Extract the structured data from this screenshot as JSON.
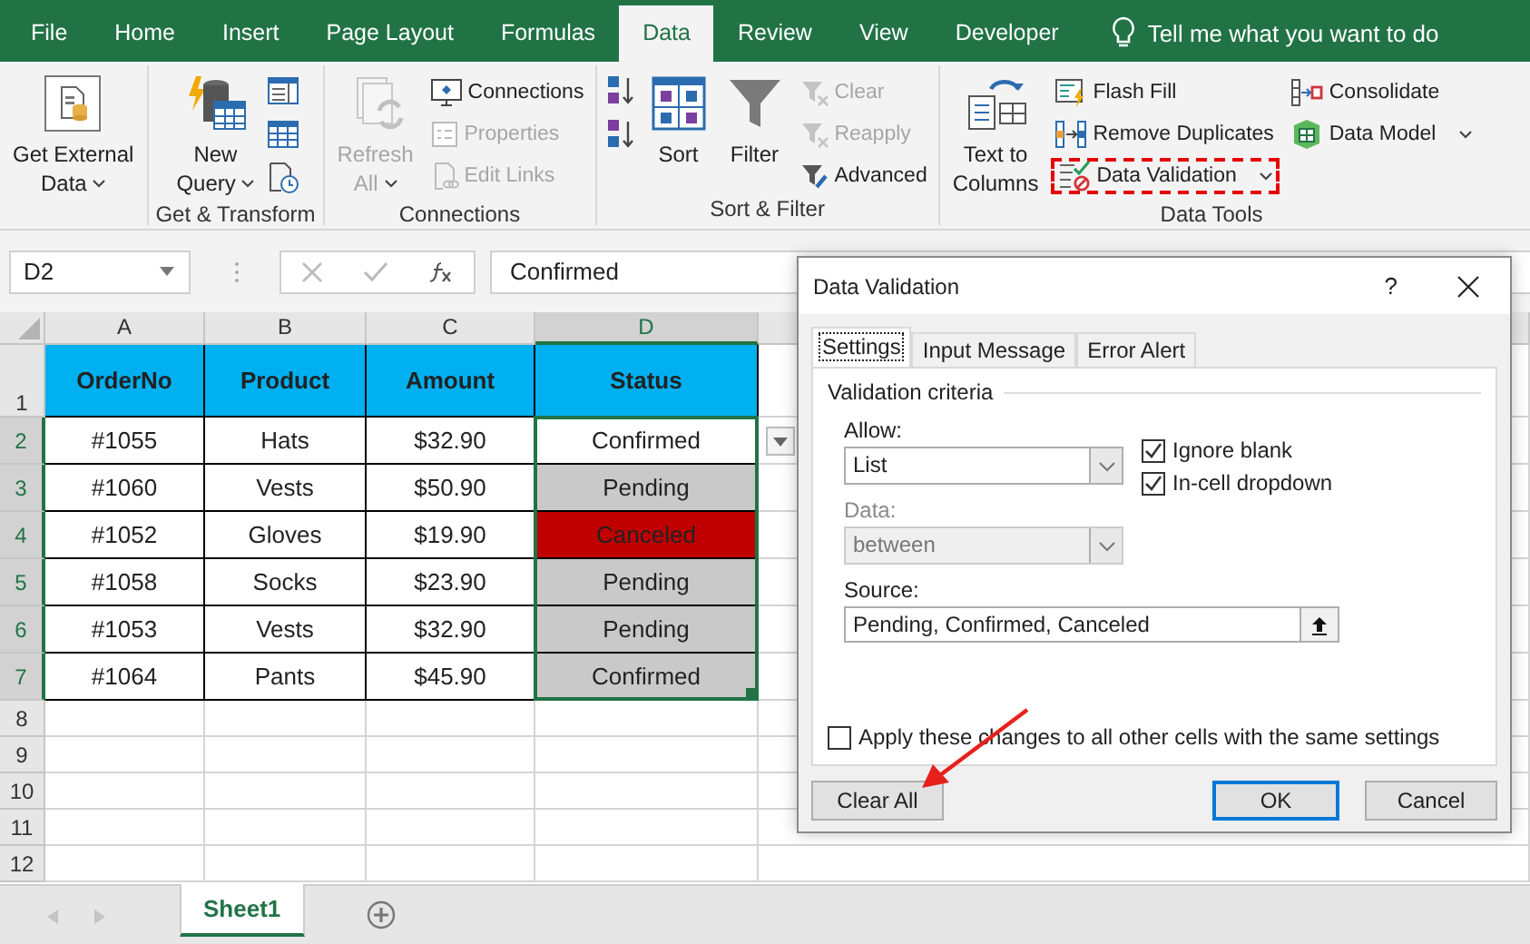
{
  "menu_tabs": [
    {
      "label": "File",
      "selected": false
    },
    {
      "label": "Home",
      "selected": false
    },
    {
      "label": "Insert",
      "selected": false
    },
    {
      "label": "Page Layout",
      "selected": false
    },
    {
      "label": "Formulas",
      "selected": false
    },
    {
      "label": "Data",
      "selected": true
    },
    {
      "label": "Review",
      "selected": false
    },
    {
      "label": "View",
      "selected": false
    },
    {
      "label": "Developer",
      "selected": false
    }
  ],
  "tell_me": "Tell me what you want to do",
  "ribbon": {
    "groups": [
      {
        "columns": [
          {
            "kind": "large",
            "items": [
              {
                "lines": [
                  "Get External",
                  "Data"
                ],
                "dropdown": true,
                "disabled": false,
                "highlighted": false
              }
            ]
          }
        ]
      },
      {
        "label": "Get & Transform",
        "columns": [
          {
            "kind": "large",
            "items": [
              {
                "lines": [
                  "New",
                  "Query"
                ],
                "dropdown": true,
                "disabled": false,
                "highlighted": false
              }
            ]
          },
          {
            "kind": "icons"
          }
        ]
      },
      {
        "label": "Connections",
        "columns": [
          {
            "kind": "large",
            "items": [
              {
                "lines": [
                  "Refresh",
                  "All"
                ],
                "dropdown": true,
                "disabled": true,
                "highlighted": false
              }
            ]
          },
          {
            "kind": "stack",
            "items": [
              {
                "label": "Connections",
                "dropdown": false,
                "disabled": false,
                "highlighted": false
              },
              {
                "label": "Properties",
                "dropdown": false,
                "disabled": true,
                "highlighted": false
              },
              {
                "label": "Edit Links",
                "dropdown": false,
                "disabled": true,
                "highlighted": false
              }
            ]
          }
        ]
      },
      {
        "label": "Sort & Filter",
        "columns": [
          {
            "kind": "icons"
          },
          {
            "kind": "large",
            "items": [
              {
                "lines": [
                  "Sort"
                ],
                "dropdown": false,
                "disabled": false,
                "highlighted": false
              }
            ]
          },
          {
            "kind": "large",
            "items": [
              {
                "lines": [
                  "Filter"
                ],
                "dropdown": false,
                "disabled": false,
                "highlighted": false
              }
            ]
          },
          {
            "kind": "stack",
            "items": [
              {
                "label": "Clear",
                "dropdown": false,
                "disabled": true,
                "highlighted": false
              },
              {
                "label": "Reapply",
                "dropdown": false,
                "disabled": true,
                "highlighted": false
              },
              {
                "label": "Advanced",
                "dropdown": false,
                "disabled": false,
                "highlighted": false
              }
            ]
          }
        ]
      },
      {
        "label": "Data Tools",
        "columns": [
          {
            "kind": "large",
            "items": [
              {
                "lines": [
                  "Text to",
                  "Columns"
                ],
                "dropdown": false,
                "disabled": false,
                "highlighted": false
              }
            ]
          },
          {
            "kind": "stack",
            "items": [
              {
                "label": "Flash Fill",
                "dropdown": false,
                "disabled": false,
                "highlighted": false
              },
              {
                "label": "Remove Duplicates",
                "dropdown": false,
                "disabled": false,
                "highlighted": false
              },
              {
                "label": "Data Validation",
                "dropdown": true,
                "disabled": false,
                "highlighted": true
              }
            ]
          },
          {
            "kind": "stack",
            "items": [
              {
                "label": "Consolidate",
                "dropdown": false,
                "disabled": false,
                "highlighted": false
              },
              {
                "label": "Data Model",
                "dropdown": true,
                "disabled": false,
                "highlighted": false
              }
            ]
          }
        ]
      }
    ]
  },
  "name_box": "D2",
  "formula": "Confirmed",
  "columns": [
    {
      "letter": "A",
      "selected": false
    },
    {
      "letter": "B",
      "selected": false
    },
    {
      "letter": "C",
      "selected": false
    },
    {
      "letter": "D",
      "selected": true
    }
  ],
  "rows": [
    {
      "number": "1",
      "kind": "header",
      "selected": false,
      "cells": [
        {
          "text": "OrderNo",
          "color": "#00b0f0"
        },
        {
          "text": "Product",
          "color": "#00b0f0"
        },
        {
          "text": "Amount",
          "color": "#00b0f0"
        },
        {
          "text": "Status",
          "color": "#00b0f0"
        }
      ]
    },
    {
      "number": "2",
      "kind": "data",
      "selected": true,
      "cells": [
        {
          "text": "#1055",
          "color": "#ffffff"
        },
        {
          "text": "Hats",
          "color": "#ffffff"
        },
        {
          "text": "$32.90",
          "color": "#ffffff"
        },
        {
          "text": "Confirmed",
          "color": "#ffffff"
        }
      ]
    },
    {
      "number": "3",
      "kind": "data",
      "selected": true,
      "cells": [
        {
          "text": "#1060",
          "color": "#ffffff"
        },
        {
          "text": "Vests",
          "color": "#ffffff"
        },
        {
          "text": "$50.90",
          "color": "#ffffff"
        },
        {
          "text": "Pending",
          "color": "#c9c9c9"
        }
      ]
    },
    {
      "number": "4",
      "kind": "data",
      "selected": true,
      "cells": [
        {
          "text": "#1052",
          "color": "#ffffff"
        },
        {
          "text": "Gloves",
          "color": "#ffffff"
        },
        {
          "text": "$19.90",
          "color": "#ffffff"
        },
        {
          "text": "Canceled",
          "color": "#c00000"
        }
      ]
    },
    {
      "number": "5",
      "kind": "data",
      "selected": true,
      "cells": [
        {
          "text": "#1058",
          "color": "#ffffff"
        },
        {
          "text": "Socks",
          "color": "#ffffff"
        },
        {
          "text": "$23.90",
          "color": "#ffffff"
        },
        {
          "text": "Pending",
          "color": "#c9c9c9"
        }
      ]
    },
    {
      "number": "6",
      "kind": "data",
      "selected": true,
      "cells": [
        {
          "text": "#1053",
          "color": "#ffffff"
        },
        {
          "text": "Vests",
          "color": "#ffffff"
        },
        {
          "text": "$32.90",
          "color": "#ffffff"
        },
        {
          "text": "Pending",
          "color": "#c9c9c9"
        }
      ]
    },
    {
      "number": "7",
      "kind": "data",
      "selected": true,
      "cells": [
        {
          "text": "#1064",
          "color": "#ffffff"
        },
        {
          "text": "Pants",
          "color": "#ffffff"
        },
        {
          "text": "$45.90",
          "color": "#ffffff"
        },
        {
          "text": "Confirmed",
          "color": "#c9c9c9"
        }
      ]
    },
    {
      "number": "8",
      "kind": "empty",
      "selected": false
    },
    {
      "number": "9",
      "kind": "empty",
      "selected": false
    },
    {
      "number": "10",
      "kind": "empty",
      "selected": false
    },
    {
      "number": "11",
      "kind": "empty",
      "selected": false
    },
    {
      "number": "12",
      "kind": "empty",
      "selected": false
    }
  ],
  "in_cell_dropdown": true,
  "sheet_tabs": [
    {
      "label": "Sheet1",
      "selected": true
    }
  ],
  "dialog": {
    "title": "Data Validation",
    "help": "?",
    "tabs": [
      {
        "label": "Settings",
        "selected": true
      },
      {
        "label": "Input Message",
        "selected": false
      },
      {
        "label": "Error Alert",
        "selected": false
      }
    ],
    "section": "Validation criteria",
    "selects": [
      {
        "label": "Allow:",
        "value": "List",
        "disabled": false
      },
      {
        "label": "Data:",
        "value": "between",
        "disabled": true
      }
    ],
    "options": [
      {
        "label": "Ignore blank",
        "checked": true
      },
      {
        "label": "In-cell dropdown",
        "checked": true
      }
    ],
    "source": {
      "label": "Source:",
      "value": "Pending, Confirmed, Canceled"
    },
    "apply": {
      "label": "Apply these changes to all other cells with the same settings",
      "checked": false
    },
    "buttons": [
      {
        "label": "Clear All",
        "default": false
      },
      {
        "label": "OK",
        "default": true
      },
      {
        "label": "Cancel",
        "default": false
      }
    ]
  }
}
